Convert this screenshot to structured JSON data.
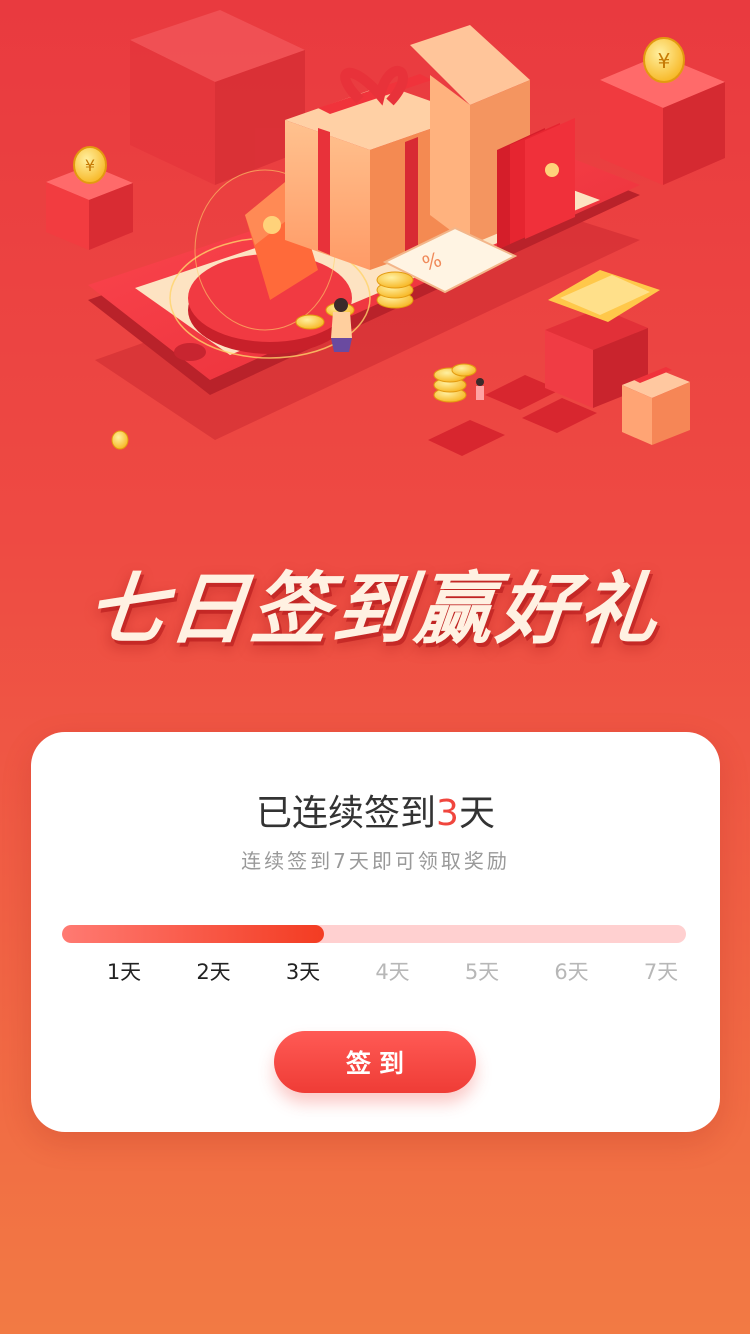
{
  "banner": {
    "title": "七日签到赢好礼"
  },
  "checkin": {
    "headline_prefix": "已连续签到",
    "headline_count": "3",
    "headline_suffix": "天",
    "subtitle": "连续签到7天即可领取奖励",
    "progress_fraction": 0.42,
    "days": [
      "1天",
      "2天",
      "3天",
      "4天",
      "5天",
      "6天",
      "7天"
    ],
    "completed_days": 3,
    "button_label": "签到"
  },
  "colors": {
    "accent": "#f0463e",
    "progress_track": "#ffd0d0",
    "progress_fill_start": "#ff7a72",
    "progress_fill_end": "#f33c22",
    "future_day_text": "#b7b7b7"
  },
  "illustration": {
    "icons": [
      "phone-icon",
      "gift-box-icon",
      "shopping-bag-icon",
      "red-envelope-icon",
      "coin-icon",
      "coupon-icon",
      "gold-treasure-box-icon",
      "person-icon"
    ]
  }
}
